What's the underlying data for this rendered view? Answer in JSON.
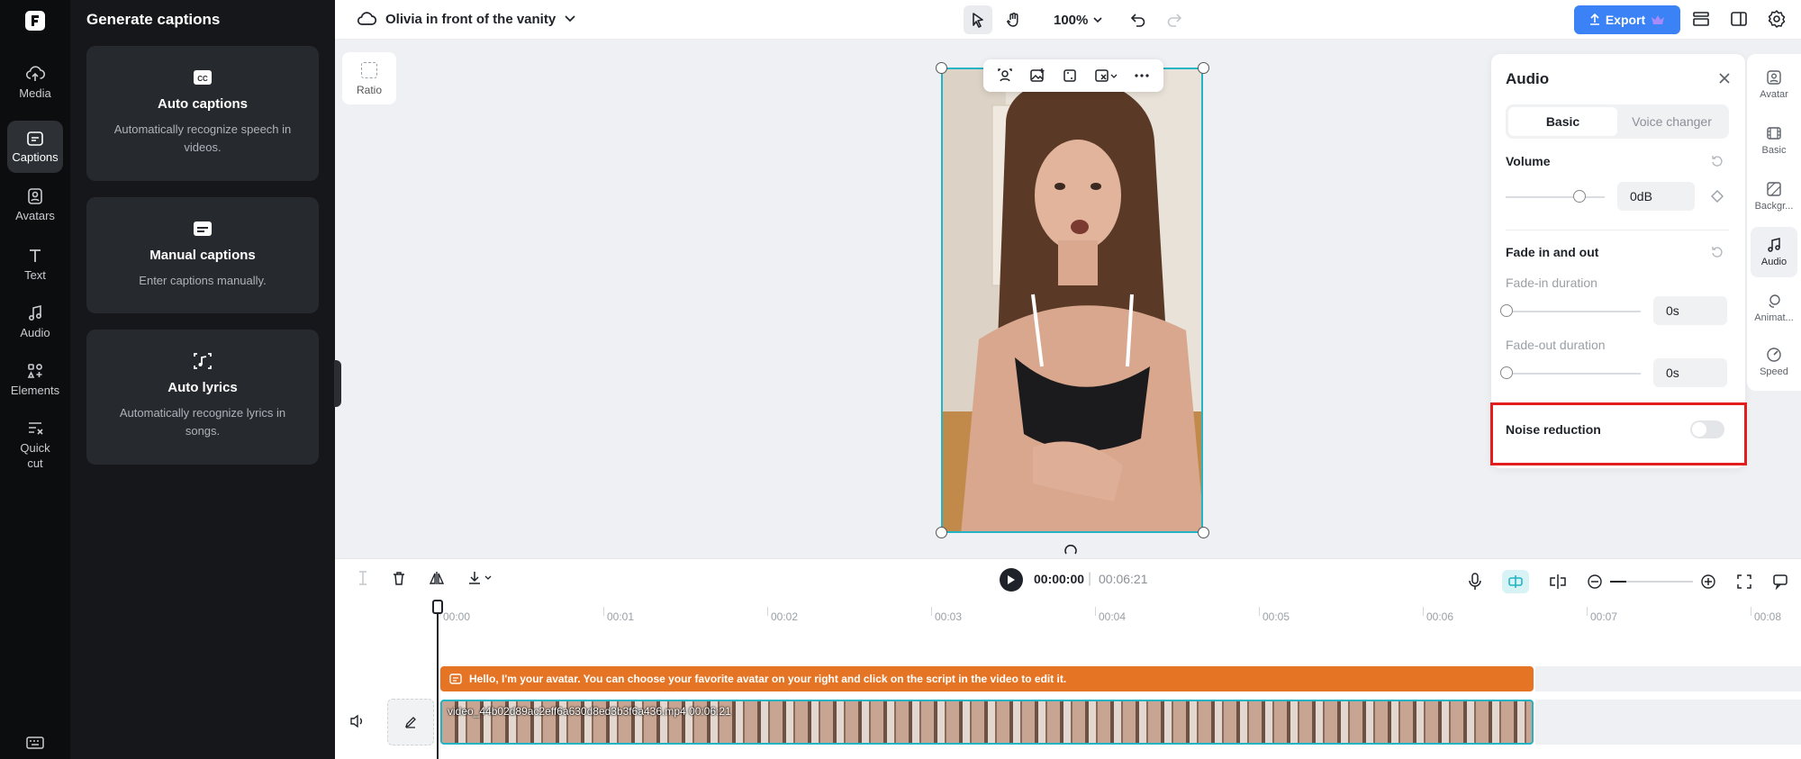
{
  "left_rail": {
    "items": [
      {
        "label": "Media",
        "icon": "cloud-upload-icon"
      },
      {
        "label": "Captions",
        "icon": "captions-icon"
      },
      {
        "label": "Avatars",
        "icon": "avatar-icon"
      },
      {
        "label": "Text",
        "icon": "text-icon"
      },
      {
        "label": "Audio",
        "icon": "music-note-icon"
      },
      {
        "label": "Elements",
        "icon": "elements-icon"
      },
      {
        "label": "Quick\ncut",
        "icon": "quick-cut-icon"
      }
    ],
    "active": "Captions"
  },
  "captions_panel": {
    "title": "Generate captions",
    "cards": [
      {
        "title": "Auto captions",
        "desc": "Automatically recognize speech in videos.",
        "icon": "cc-icon"
      },
      {
        "title": "Manual captions",
        "desc": "Enter captions manually.",
        "icon": "subtitle-icon"
      },
      {
        "title": "Auto lyrics",
        "desc": "Automatically recognize lyrics in songs.",
        "icon": "lyrics-icon"
      }
    ]
  },
  "topbar": {
    "project_name": "Olivia in front of the vanity",
    "zoom": "100%",
    "export_label": "Export"
  },
  "canvas": {
    "ratio_label": "Ratio"
  },
  "audio_panel": {
    "title": "Audio",
    "tabs": [
      "Basic",
      "Voice changer"
    ],
    "active_tab": "Basic",
    "volume_label": "Volume",
    "volume_value": "0dB",
    "fade_section": "Fade in and out",
    "fade_in_label": "Fade-in duration",
    "fade_in_value": "0s",
    "fade_out_label": "Fade-out duration",
    "fade_out_value": "0s",
    "noise_reduction_label": "Noise reduction",
    "noise_reduction_on": false
  },
  "property_rail": {
    "items": [
      "Avatar",
      "Basic",
      "Backgr...",
      "Audio",
      "Animat...",
      "Speed"
    ],
    "active": "Audio"
  },
  "timeline": {
    "current_time": "00:00:00",
    "separator": "|",
    "total_time": "00:06:21",
    "ruler": [
      "00:00",
      "00:01",
      "00:02",
      "00:03",
      "00:04",
      "00:05",
      "00:06",
      "00:07",
      "00:08"
    ],
    "caption_text": "Hello, I'm your avatar. You can choose your favorite avatar on your right and click on the script in the video to edit it.",
    "video_clip_label": "video_44b02d89ac2eff6a630d8ed3b3f6a436.mp4   00:06:21"
  },
  "colors": {
    "accent": "#3b82f6",
    "selection": "#22b3c4",
    "caption_clip": "#e67425",
    "highlight": "#e11d1d"
  }
}
